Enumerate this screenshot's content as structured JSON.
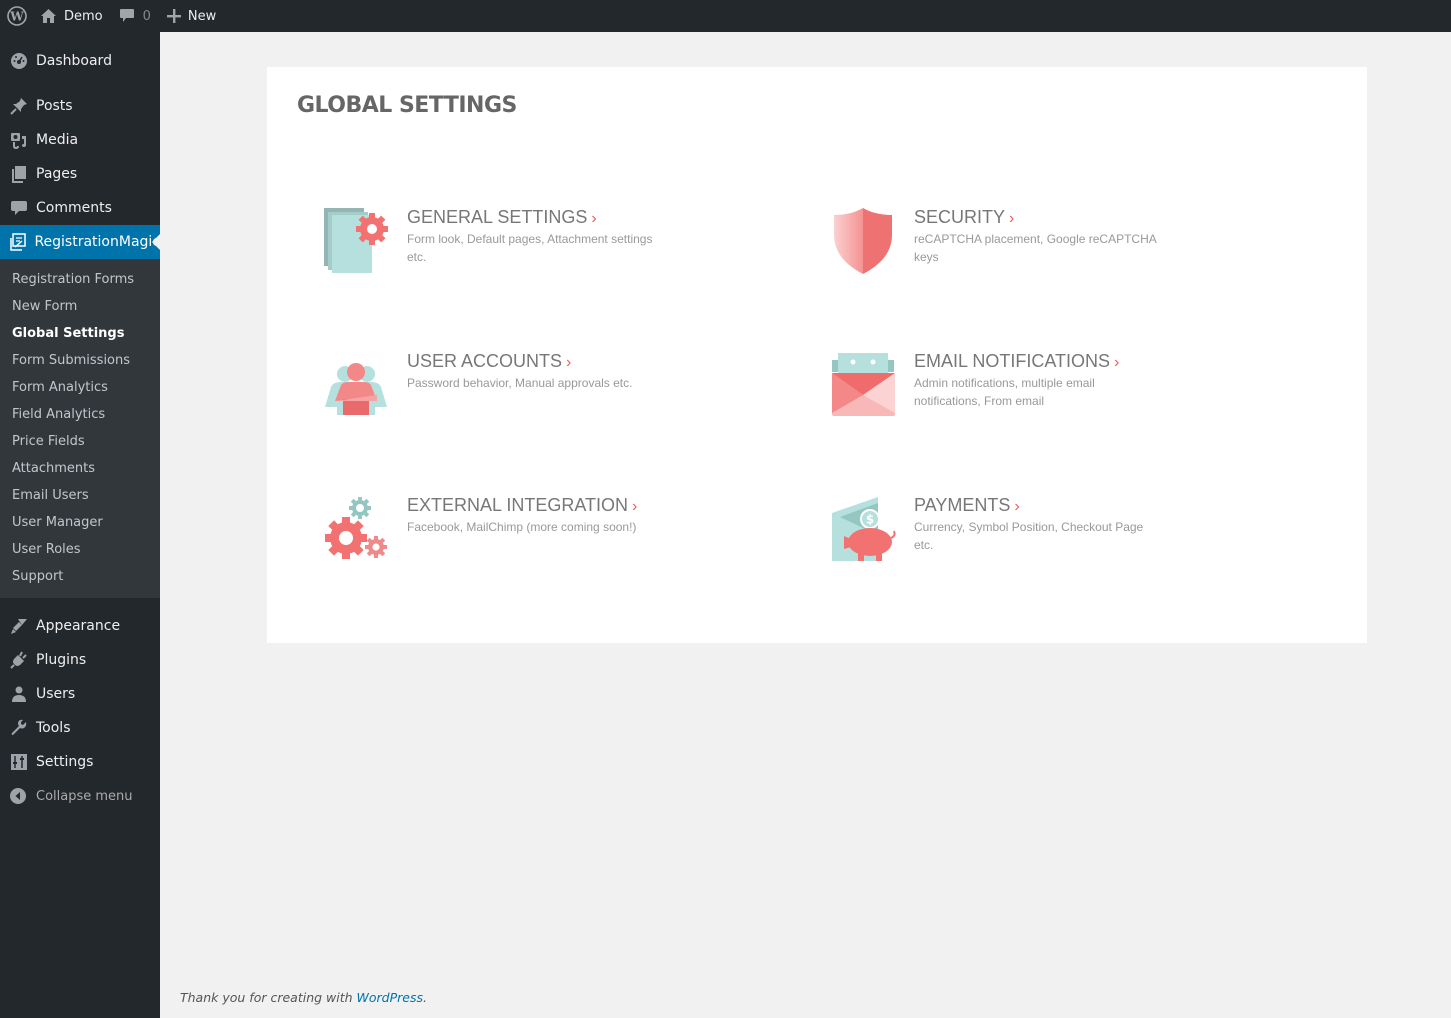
{
  "adminbar": {
    "site_name": "Demo",
    "comment_count": "0",
    "new_label": "New"
  },
  "sidebar": {
    "top_items": [
      {
        "label": "Dashboard",
        "icon": "dashboard-icon"
      }
    ],
    "mid_items": [
      {
        "label": "Posts",
        "icon": "pin-icon"
      },
      {
        "label": "Media",
        "icon": "media-icon"
      },
      {
        "label": "Pages",
        "icon": "pages-icon"
      },
      {
        "label": "Comments",
        "icon": "comment-icon"
      }
    ],
    "active_item": {
      "label": "RegistrationMagic",
      "icon": "registration-form-icon"
    },
    "submenu": [
      {
        "label": "Registration Forms"
      },
      {
        "label": "New Form"
      },
      {
        "label": "Global Settings",
        "current": true
      },
      {
        "label": "Form Submissions"
      },
      {
        "label": "Form Analytics"
      },
      {
        "label": "Field Analytics"
      },
      {
        "label": "Price Fields"
      },
      {
        "label": "Attachments"
      },
      {
        "label": "Email Users"
      },
      {
        "label": "User Manager"
      },
      {
        "label": "User Roles"
      },
      {
        "label": "Support"
      }
    ],
    "bottom_items": [
      {
        "label": "Appearance",
        "icon": "paintbrush-icon"
      },
      {
        "label": "Plugins",
        "icon": "plugin-icon"
      },
      {
        "label": "Users",
        "icon": "user-icon"
      },
      {
        "label": "Tools",
        "icon": "wrench-icon"
      },
      {
        "label": "Settings",
        "icon": "settings-sliders-icon"
      }
    ],
    "collapse_label": "Collapse menu"
  },
  "main": {
    "title": "GLOBAL SETTINGS",
    "arrow": "›",
    "cards": [
      {
        "title": "GENERAL SETTINGS",
        "description": "Form look, Default pages, Attachment settings etc.",
        "icon": "general-settings-icon"
      },
      {
        "title": "SECURITY",
        "description": "reCAPTCHA placement, Google reCAPTCHA keys",
        "icon": "shield-icon"
      },
      {
        "title": "USER ACCOUNTS",
        "description": "Password behavior, Manual approvals etc.",
        "icon": "user-accounts-icon"
      },
      {
        "title": "EMAIL NOTIFICATIONS",
        "description": "Admin notifications, multiple email notifications, From email",
        "icon": "envelope-icon"
      },
      {
        "title": "EXTERNAL INTEGRATION",
        "description": "Facebook, MailChimp (more coming soon!)",
        "icon": "gears-icon"
      },
      {
        "title": "PAYMENTS",
        "description": "Currency, Symbol Position, Checkout Page etc.",
        "icon": "piggy-bank-icon"
      }
    ]
  },
  "footer": {
    "text": "Thank you for creating with ",
    "link": "WordPress",
    "suffix": "."
  },
  "colors": {
    "accent": "#0073aa",
    "adminbar_bg": "#23282d",
    "submenu_bg": "#32373c",
    "icon_red": "#f27171",
    "icon_teal": "#b5e0dd",
    "arrow_red": "#f05a5b"
  }
}
